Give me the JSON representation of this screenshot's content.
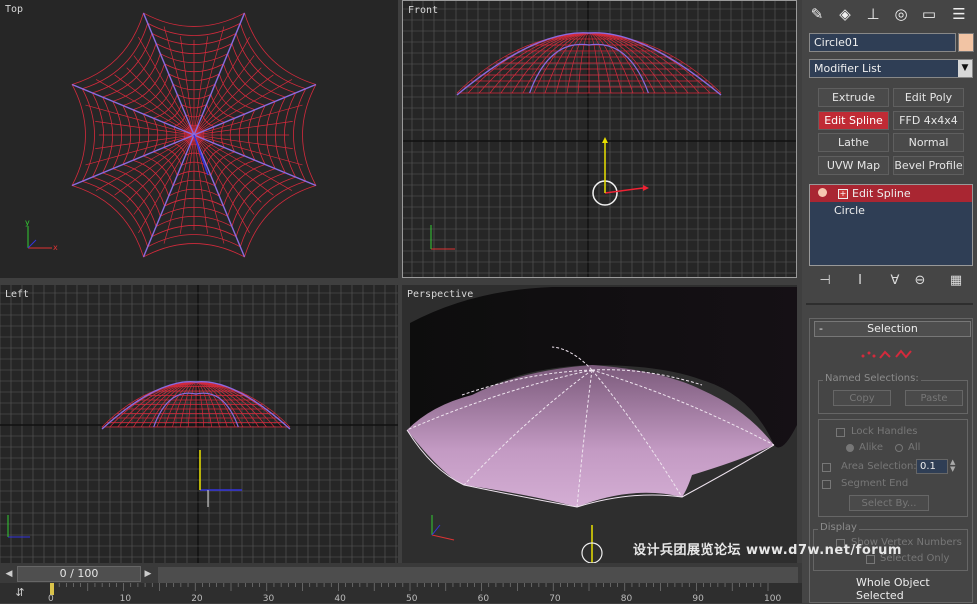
{
  "viewports": {
    "top": "Top",
    "front": "Front",
    "left": "Left",
    "perspective": "Perspective"
  },
  "axis_labels": {
    "x": "x",
    "y": "y",
    "z": "z"
  },
  "command_panel": {
    "tabs": [
      "create-icon",
      "modify-icon",
      "hierarchy-icon",
      "motion-icon",
      "display-icon",
      "utilities-icon"
    ],
    "object_name": "Circle01",
    "object_color": "#f2c4a4",
    "modifier_list": "Modifier List",
    "modifier_buttons": [
      "Extrude",
      "Edit Poly",
      "Edit Spline",
      "FFD 4x4x4",
      "Lathe",
      "Normal",
      "UVW Map",
      "Bevel Profile"
    ],
    "active_modifier": "Edit Spline",
    "stack": [
      {
        "label": "Edit Spline",
        "selected": true
      },
      {
        "label": "Circle",
        "selected": false
      }
    ],
    "stack_tools": [
      "pin-stack-icon",
      "show-end-result-icon",
      "make-unique-icon",
      "remove-modifier-icon",
      "configure-sets-icon"
    ]
  },
  "selection_rollout": {
    "title": "Selection",
    "named_selections": {
      "title": "Named Selections:",
      "copy": "Copy",
      "paste": "Paste"
    },
    "lock_handles": "Lock Handles",
    "alike": "Alike",
    "all": "All",
    "area_selection": "Area Selection:",
    "area_value": "0.1",
    "segment_end": "Segment End",
    "select_by": "Select By...",
    "display": {
      "title": "Display",
      "show_vertex_numbers": "Show Vertex Numbers",
      "selected_only": "Selected Only"
    },
    "status": "Whole Object Selected"
  },
  "timeline": {
    "frame": "0 / 100",
    "ticks": [
      "0",
      "10",
      "20",
      "30",
      "40",
      "50",
      "60",
      "70",
      "80",
      "90",
      "100"
    ]
  },
  "watermark": "设计兵团展览论坛 www.d7w.net/forum",
  "colors": {
    "wire": "#d42a3c",
    "spline": "#8a6be0",
    "active": "#c02b35",
    "field_bg": "#2f3e55",
    "umbrella": "#c8a0c8"
  }
}
